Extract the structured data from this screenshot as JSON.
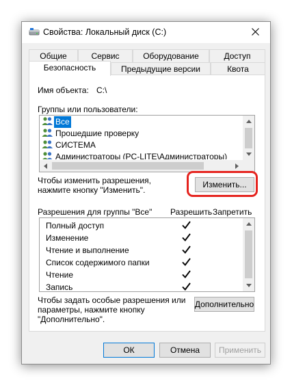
{
  "window": {
    "title": "Свойства: Локальный диск (C:)"
  },
  "tabs": {
    "row1": [
      "Общие",
      "Сервис",
      "Оборудование",
      "Доступ"
    ],
    "row2": [
      "Безопасность",
      "Предыдущие версии",
      "Квота"
    ],
    "active": "Безопасность"
  },
  "object": {
    "label": "Имя объекта:",
    "value": "C:\\"
  },
  "groups": {
    "label": "Группы или пользователи:",
    "items": [
      {
        "name": "Все",
        "icon": "users-group-icon",
        "selected": true
      },
      {
        "name": "Прошедшие проверку",
        "icon": "users-group-icon",
        "selected": false
      },
      {
        "name": "СИСТЕМА",
        "icon": "users-group-icon",
        "selected": false
      },
      {
        "name": "Администраторы (PC-LITE\\Администраторы)",
        "icon": "users-group-icon",
        "selected": false
      }
    ]
  },
  "change": {
    "hint_line1": "Чтобы изменить разрешения,",
    "hint_line2": "нажмите кнопку \"Изменить\".",
    "button": "Изменить...",
    "highlight_color": "#e5231e"
  },
  "permissions": {
    "header": "Разрешения для группы \"Все\"",
    "allow_col": "Разрешить",
    "deny_col": "Запретить",
    "rows": [
      {
        "name": "Полный доступ",
        "allow": true,
        "deny": false
      },
      {
        "name": "Изменение",
        "allow": true,
        "deny": false
      },
      {
        "name": "Чтение и выполнение",
        "allow": true,
        "deny": false
      },
      {
        "name": "Список содержимого папки",
        "allow": true,
        "deny": false
      },
      {
        "name": "Чтение",
        "allow": true,
        "deny": false
      },
      {
        "name": "Запись",
        "allow": true,
        "deny": false
      }
    ]
  },
  "advanced": {
    "hint_line1": "Чтобы задать особые разрешения или",
    "hint_line2": "параметры, нажмите кнопку",
    "hint_line3": "\"Дополнительно\".",
    "button": "Дополнительно"
  },
  "footer": {
    "ok": "ОК",
    "cancel": "Отмена",
    "apply": "Применить"
  },
  "colors": {
    "selection": "#0078d7",
    "accent_border": "#0078d7"
  }
}
